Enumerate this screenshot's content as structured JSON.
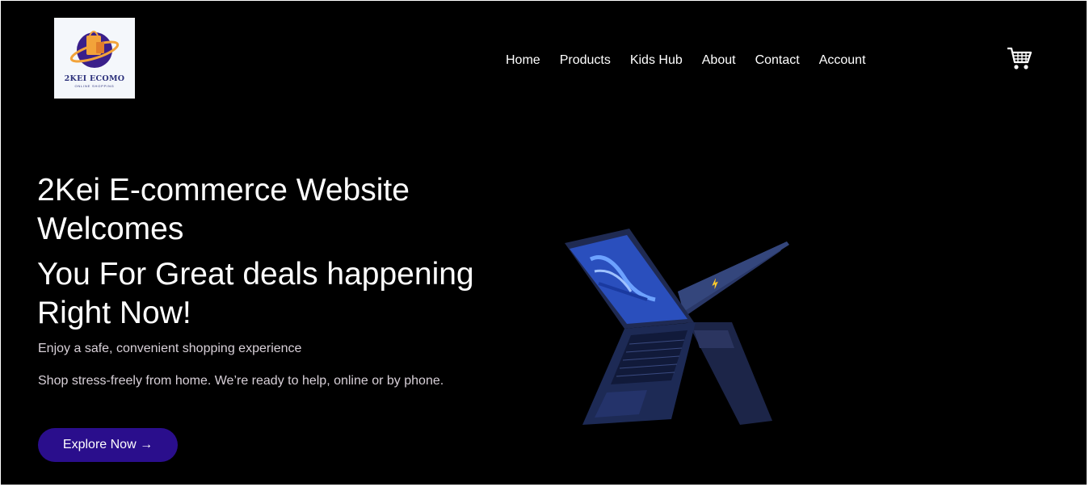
{
  "brand": {
    "name": "2KEI ECOMO",
    "tagline": "ONLINE SHOPPING"
  },
  "nav": {
    "items": [
      "Home",
      "Products",
      "Kids Hub",
      "About",
      "Contact",
      "Account"
    ]
  },
  "cart": {
    "icon": "shopping-cart-icon"
  },
  "hero": {
    "heading_line1": "2Kei E-commerce Website Welcomes",
    "heading_line2": "You For Great deals happening Right Now!",
    "subtext1": "Enjoy a safe, convenient shopping experience",
    "subtext2": "Shop stress-freely from home. We’re ready to help, online or by phone.",
    "cta_label": "Explore Now →",
    "image": "laptop-pair-image"
  },
  "colors": {
    "background": "#000000",
    "cta": "#2a0e8c",
    "text": "#ffffff",
    "subtext": "#d8d0d8"
  }
}
